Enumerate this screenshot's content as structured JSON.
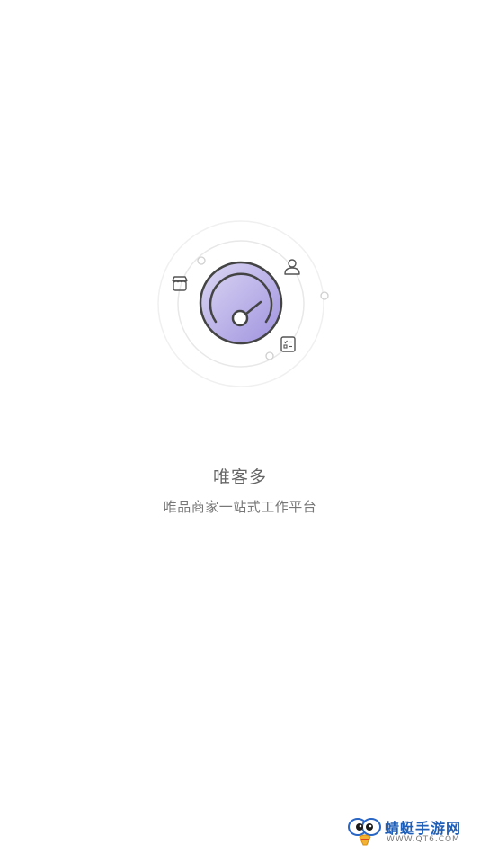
{
  "splash": {
    "app_name": "唯客多",
    "slogan": "唯品商家一站式工作平台"
  },
  "watermark": {
    "title": "蜻蜓手游网",
    "url": "WWW.QT6.COM"
  },
  "icons": {
    "gauge": "speedometer-icon",
    "store": "store-icon",
    "user": "user-icon",
    "checklist": "checklist-icon"
  },
  "colors": {
    "gauge_fill_light": "#d9d4f3",
    "gauge_fill_dark": "#a79ae2",
    "outline": "#444444",
    "orbit": "#ececec",
    "watermark_blue": "#1f5fb8"
  }
}
